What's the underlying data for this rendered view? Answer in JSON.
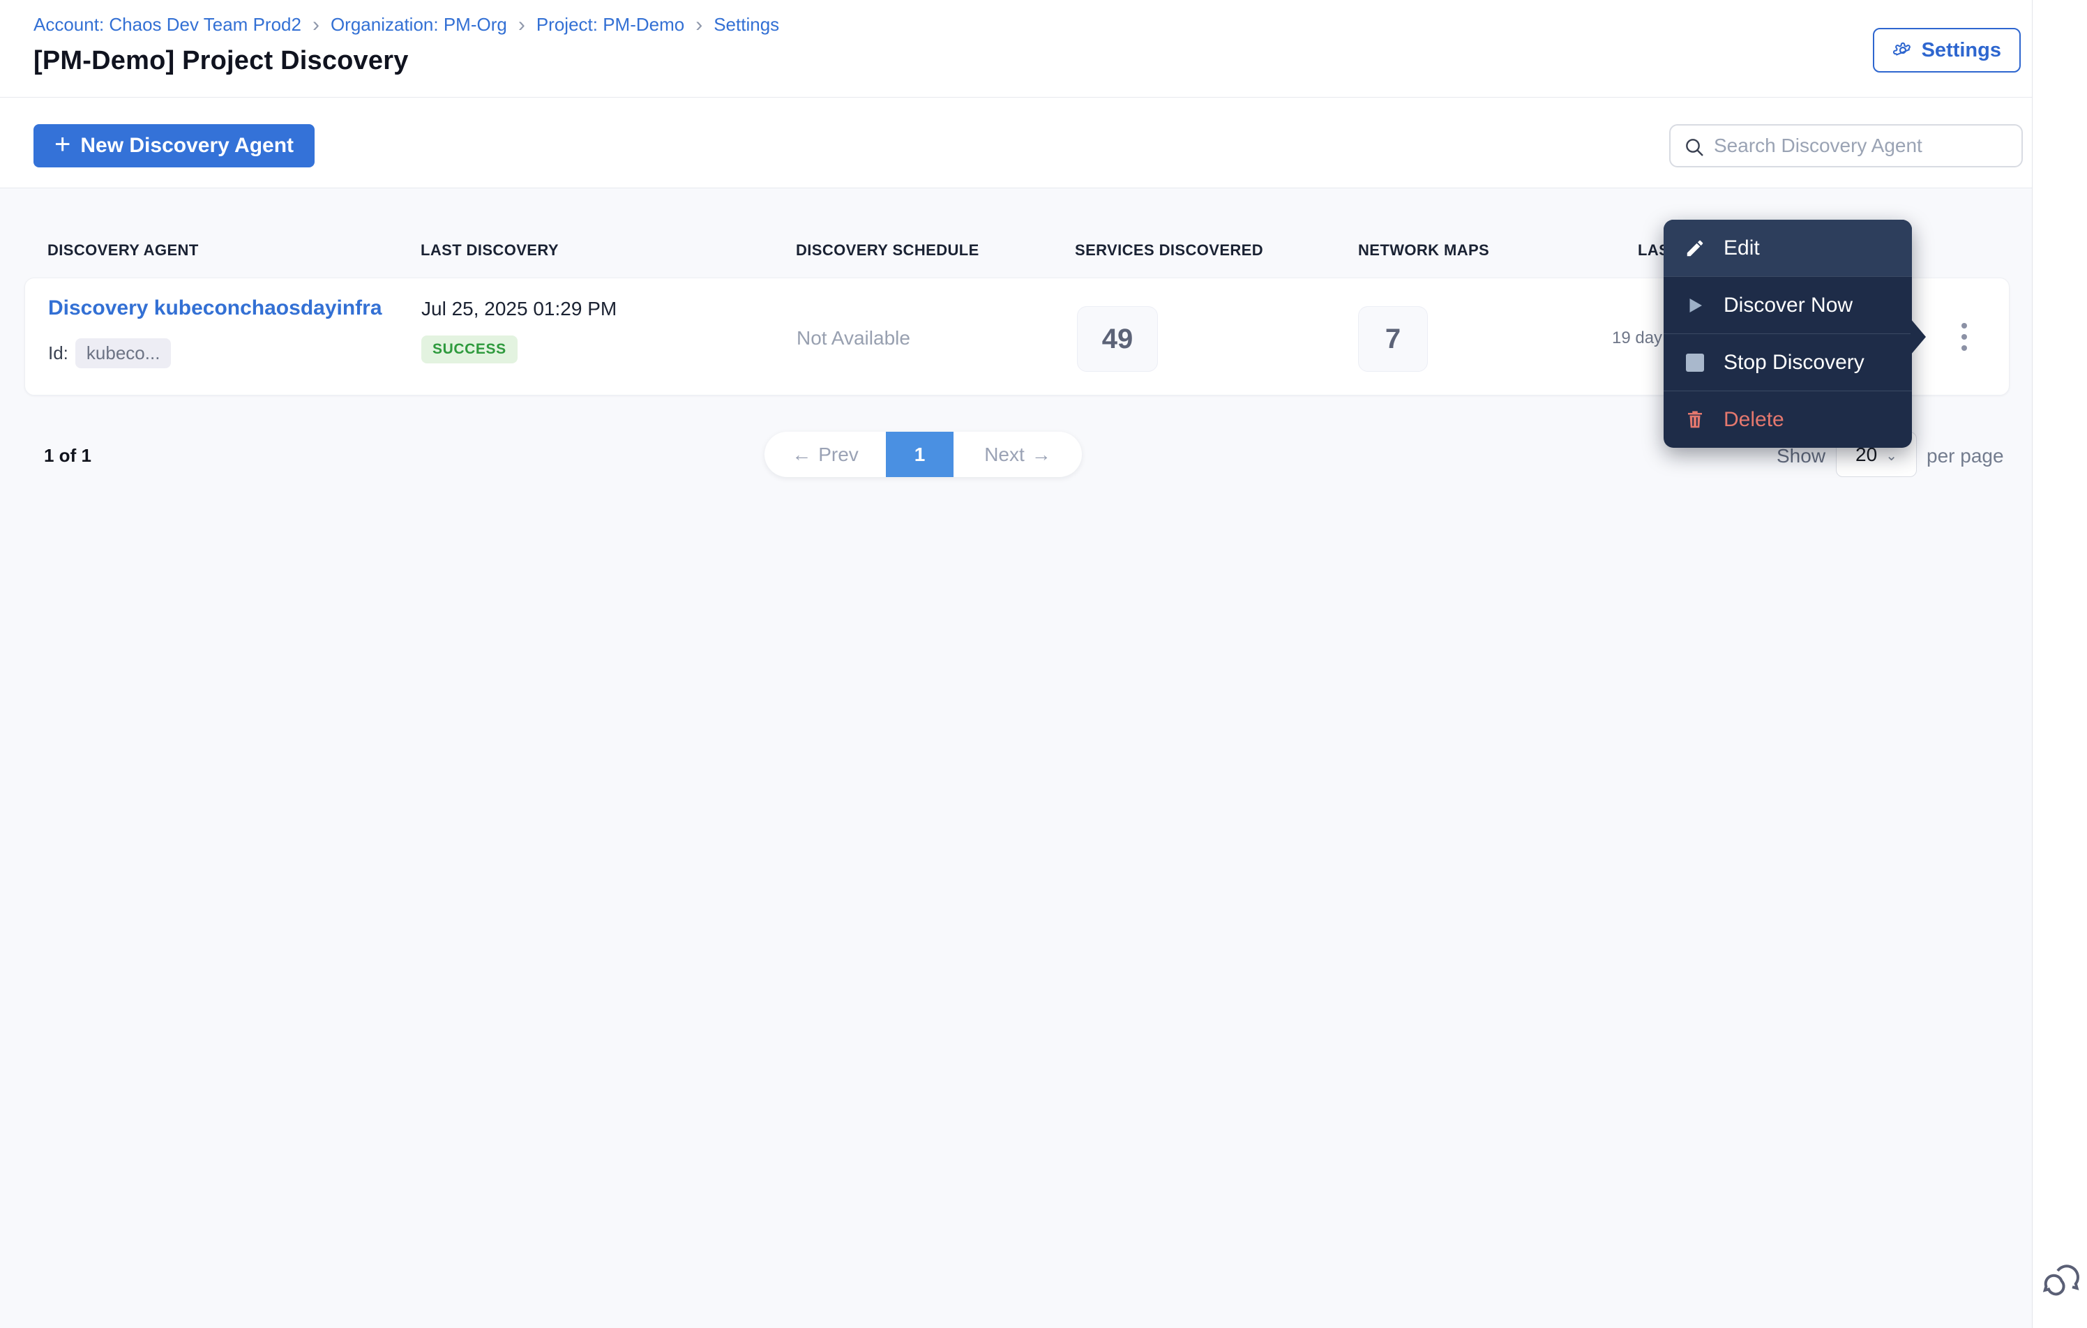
{
  "breadcrumb": {
    "separator": "›",
    "items": [
      {
        "label": "Account: Chaos Dev Team Prod2"
      },
      {
        "label": "Organization: PM-Org"
      },
      {
        "label": "Project: PM-Demo"
      },
      {
        "label": "Settings"
      }
    ]
  },
  "header": {
    "title": "[PM-Demo] Project Discovery",
    "settings_button": "Settings"
  },
  "toolbar": {
    "new_agent_button": "New Discovery Agent",
    "plus_glyph": "+",
    "search_placeholder": "Search Discovery Agent"
  },
  "table": {
    "columns": [
      "DISCOVERY AGENT",
      "LAST DISCOVERY",
      "DISCOVERY SCHEDULE",
      "SERVICES DISCOVERED",
      "NETWORK MAPS",
      "LAST"
    ],
    "rows": [
      {
        "agent_name": "Discovery kubeconchaosdayinfra",
        "id_label": "Id:",
        "id_value": "kubeco...",
        "last_discovery": "Jul 25, 2025 01:29 PM",
        "status": "SUCCESS",
        "discovery_schedule": "Not Available",
        "services_discovered": "49",
        "network_maps": "7",
        "last_value": "19 day"
      }
    ]
  },
  "context_menu": {
    "items": [
      {
        "label": "Edit",
        "icon": "pencil-icon"
      },
      {
        "label": "Discover Now",
        "icon": "play-icon"
      },
      {
        "label": "Stop Discovery",
        "icon": "stop-icon"
      },
      {
        "label": "Delete",
        "icon": "trash-icon"
      }
    ]
  },
  "pagination": {
    "summary": "1 of 1",
    "prev_label": "Prev",
    "prev_arrow": "←",
    "page": "1",
    "next_label": "Next",
    "next_arrow": "→",
    "show_label": "Show",
    "page_size": "20",
    "chevron": "⌄",
    "per_page_label": "per page"
  },
  "colors": {
    "primary_blue": "#3472d8",
    "link_blue": "#3370d4",
    "outline_blue": "#2e66cf",
    "active_page_blue": "#4a90e2",
    "success_text": "#2e9a3d",
    "success_bg": "#e3f3e0",
    "menu_bg": "#1e2c48",
    "menu_highlight": "#2d3e5c",
    "danger": "#e5786e",
    "content_bg": "#f8f9fc"
  }
}
